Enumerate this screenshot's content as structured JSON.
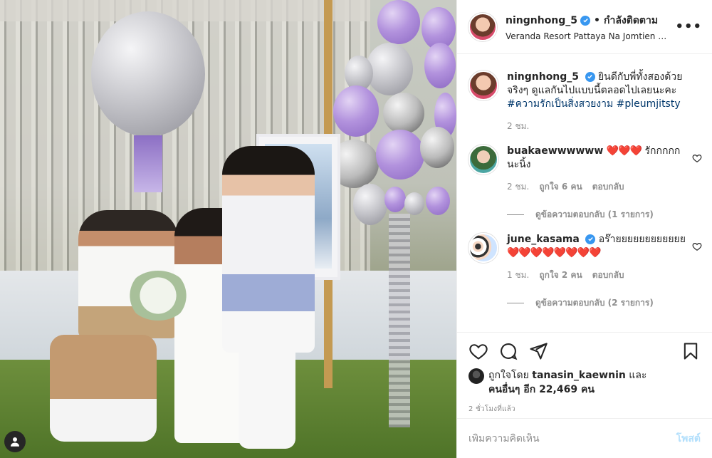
{
  "post": {
    "username": "ningnhong_5",
    "follow_status": "กำลังติดตาม",
    "dot": "•",
    "location": "Veranda Resort Pattaya Na Jomtien - MGal...",
    "more": "•••"
  },
  "caption": {
    "username": "ningnhong_5",
    "text": "ยินดีกับพี่ทั้งสองด้วยจริงๆ ดูแลกันไปแบบนี้ตลอดไปเลยนะคะ ",
    "hashtag1": "#ความรักเป็นสิ่งสวยงาม",
    "hashtag2": "#pleumjitsty",
    "time": "2 ชม."
  },
  "comments": [
    {
      "username": "buakaewwwwww",
      "hearts": "❤️❤️❤️",
      "text": " รักกกกกนะนิ้ง",
      "time": "2 ชม.",
      "likes": "ถูกใจ 6 คน",
      "reply": "ตอบกลับ",
      "view_replies": "ดูข้อความตอบกลับ (1 รายการ)"
    },
    {
      "username": "june_kasama",
      "text": " อร๊ายยยยยยยยยยยย",
      "hearts": "❤️❤️❤️❤️❤️❤️❤️❤️",
      "time": "1 ชม.",
      "likes": "ถูกใจ 2 คน",
      "reply": "ตอบกลับ",
      "view_replies": "ดูข้อความตอบกลับ (2 รายการ)"
    }
  ],
  "likes_summary": {
    "prefix": "ถูกใจโดย ",
    "user": "tanasin_kaewnin",
    "and": " และ",
    "others": "คนอื่นๆ อีก 22,469 คน"
  },
  "time_ago": "2 ชั่วโมงที่แล้ว",
  "composer": {
    "placeholder": "เพิ่มความคิดเห็น",
    "post_label": "โพสต์"
  },
  "icons": {
    "like": "heart-icon",
    "comment": "comment-icon",
    "share": "share-icon",
    "save": "bookmark-icon",
    "comment_like": "heart-outline-icon",
    "verified": "verified-badge-icon",
    "photo_tag": "user-tag-icon"
  },
  "colors": {
    "verified": "#3897f0",
    "hashtag": "#00376b",
    "heart": "#ed4956",
    "muted": "#8e8e8e",
    "post_disabled": "#b2dffc"
  }
}
